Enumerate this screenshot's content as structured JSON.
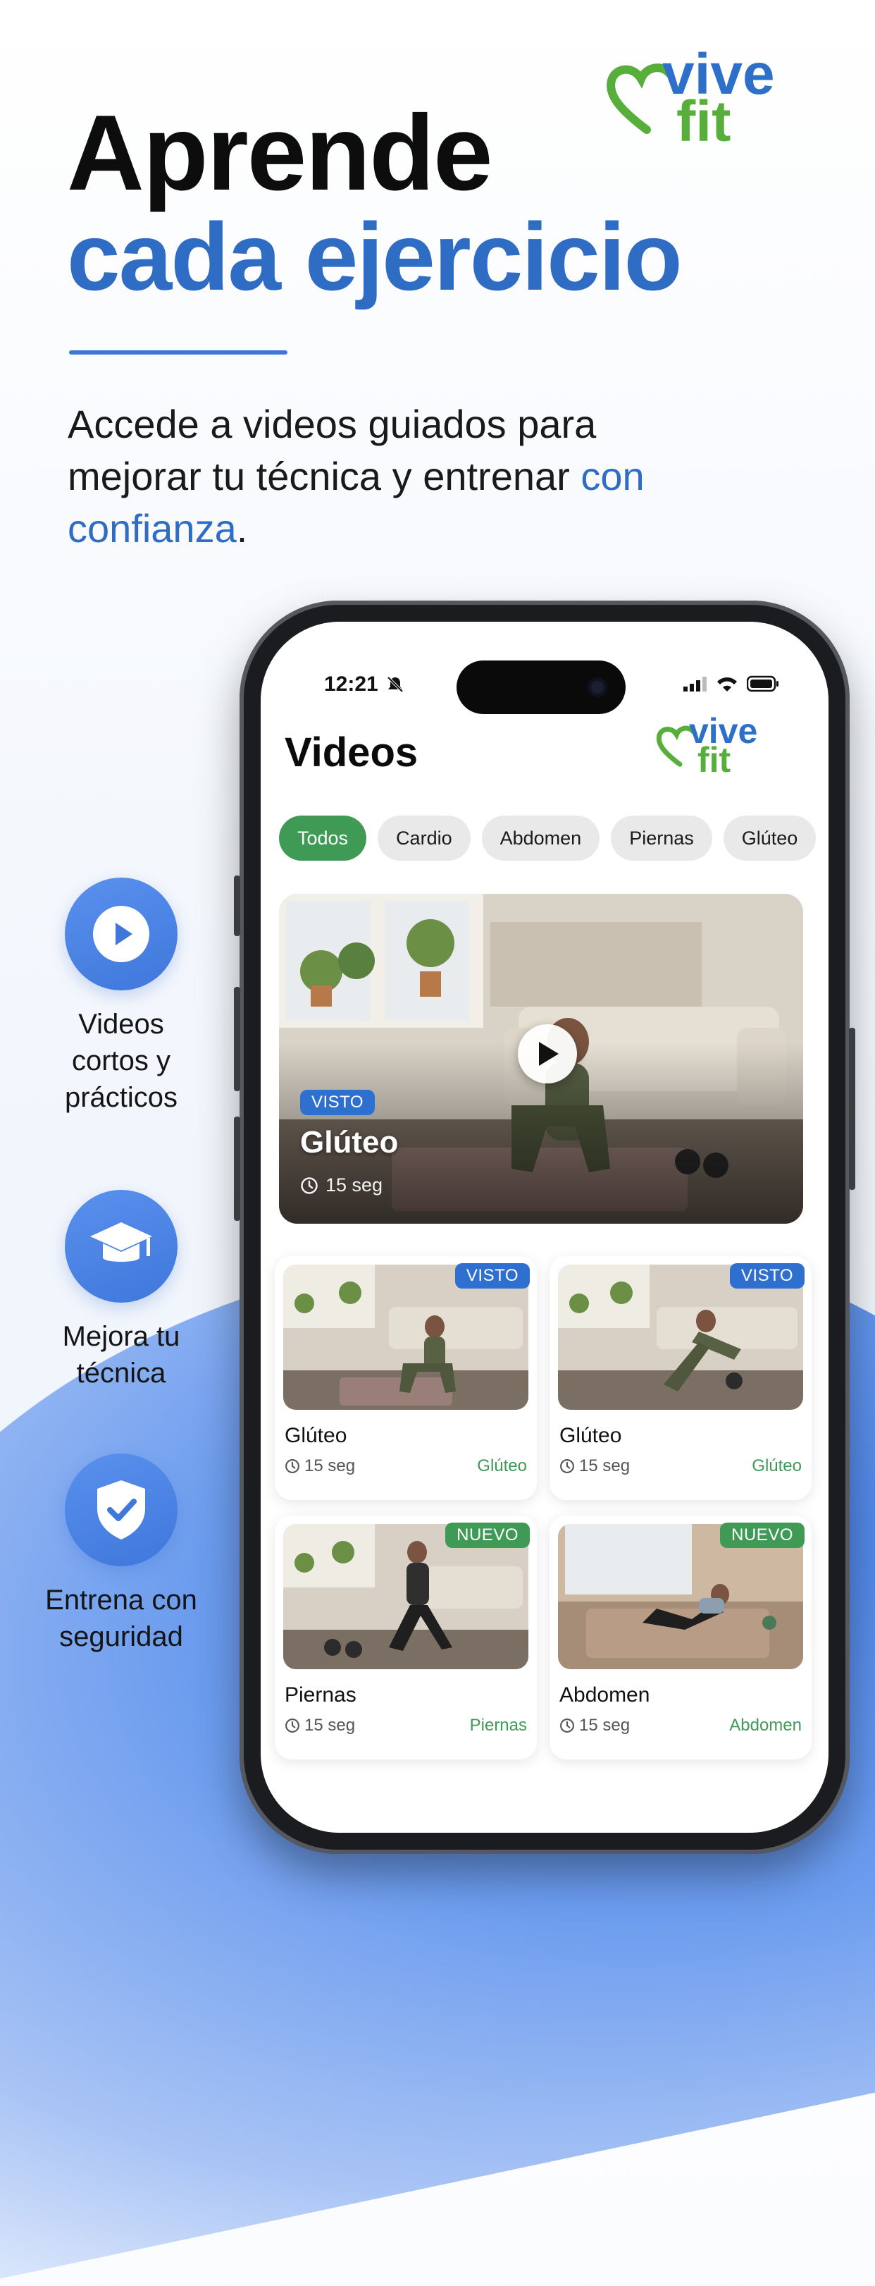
{
  "brand": {
    "line1": "vive",
    "line2": "fit"
  },
  "headline": {
    "line1": "Aprende",
    "line2": "cada ejercicio"
  },
  "subtitle": {
    "text": "Accede a videos guiados para mejorar tu técnica y entrenar ",
    "highlight": "con confianza",
    "end": "."
  },
  "features": [
    {
      "label": "Videos cortos y prácticos",
      "icon": "play-icon"
    },
    {
      "label": "Mejora tu técnica",
      "icon": "graduation-cap-icon"
    },
    {
      "label": "Entrena con seguridad",
      "icon": "shield-check-icon"
    }
  ],
  "phone": {
    "status": {
      "time": "12:21"
    },
    "app_title": "Videos",
    "filters": [
      "Todos",
      "Cardio",
      "Abdomen",
      "Piernas",
      "Glúteo"
    ],
    "active_filter": "Todos",
    "featured": {
      "badge": "VISTO",
      "title": "Glúteo",
      "duration": "15 seg"
    },
    "cards": [
      {
        "badge": "VISTO",
        "title": "Glúteo",
        "duration": "15 seg",
        "category": "Glúteo"
      },
      {
        "badge": "VISTO",
        "title": "Glúteo",
        "duration": "15 seg",
        "category": "Glúteo"
      },
      {
        "badge": "NUEVO",
        "title": "Piernas",
        "duration": "15 seg",
        "category": "Piernas"
      },
      {
        "badge": "NUEVO",
        "title": "Abdomen",
        "duration": "15 seg",
        "category": "Abdomen"
      }
    ]
  },
  "colors": {
    "accent_blue": "#2f6cc4",
    "accent_green": "#3f9a55",
    "brand_green": "#57ae3b"
  }
}
